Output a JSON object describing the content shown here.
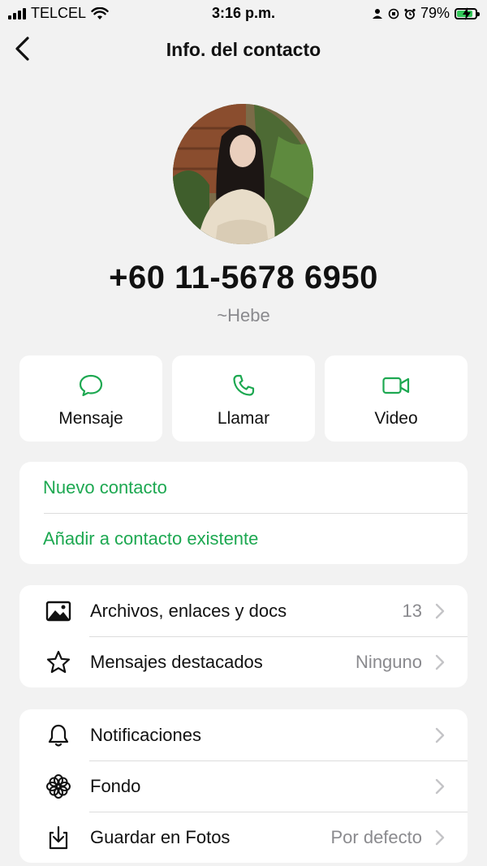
{
  "status": {
    "carrier": "TELCEL",
    "time": "3:16 p.m.",
    "battery": "79%"
  },
  "nav": {
    "title": "Info. del contacto"
  },
  "profile": {
    "phone": "+60 11-5678 6950",
    "name": "~Hebe"
  },
  "actions": [
    {
      "label": "Mensaje",
      "icon": "message-icon"
    },
    {
      "label": "Llamar",
      "icon": "phone-icon"
    },
    {
      "label": "Video",
      "icon": "video-icon"
    }
  ],
  "contact_options": [
    {
      "label": "Nuevo contacto"
    },
    {
      "label": "Añadir a contacto existente"
    }
  ],
  "media_rows": [
    {
      "label": "Archivos, enlaces y docs",
      "value": "13",
      "icon": "image-icon"
    },
    {
      "label": "Mensajes destacados",
      "value": "Ninguno",
      "icon": "star-icon"
    }
  ],
  "settings_rows": [
    {
      "label": "Notificaciones",
      "value": "",
      "icon": "bell-icon"
    },
    {
      "label": "Fondo",
      "value": "",
      "icon": "flower-icon"
    },
    {
      "label": "Guardar en Fotos",
      "value": "Por defecto",
      "icon": "download-icon"
    }
  ],
  "colors": {
    "accent": "#1da851",
    "background": "#f2f2f2",
    "secondary_text": "#8a8a8e"
  }
}
